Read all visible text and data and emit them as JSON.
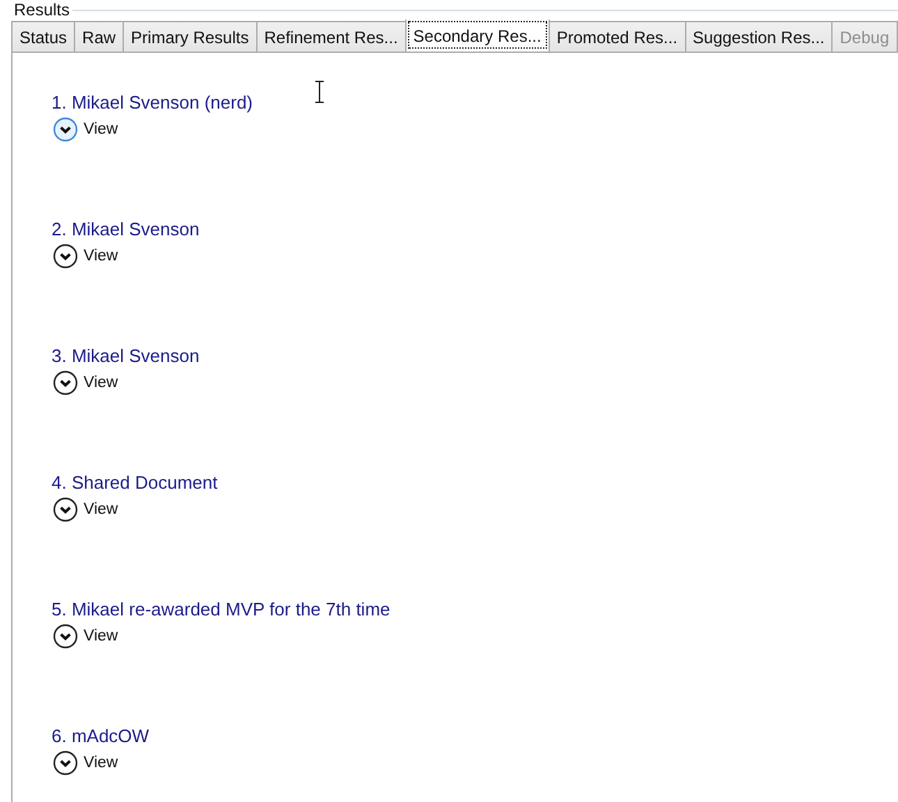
{
  "group": {
    "title": "Results"
  },
  "tabs": [
    {
      "label": "Status",
      "selected": false,
      "disabled": false
    },
    {
      "label": "Raw",
      "selected": false,
      "disabled": false
    },
    {
      "label": "Primary Results",
      "selected": false,
      "disabled": false
    },
    {
      "label": "Refinement Res...",
      "selected": false,
      "disabled": false
    },
    {
      "label": "Secondary Res...",
      "selected": true,
      "disabled": false
    },
    {
      "label": "Promoted Res...",
      "selected": false,
      "disabled": false
    },
    {
      "label": "Suggestion Res...",
      "selected": false,
      "disabled": false
    },
    {
      "label": "Debug",
      "selected": false,
      "disabled": true
    }
  ],
  "results": [
    {
      "title": "1. Mikael Svenson (nerd)",
      "action": "View",
      "highlighted": true
    },
    {
      "title": "2. Mikael Svenson",
      "action": "View",
      "highlighted": false
    },
    {
      "title": "3. Mikael Svenson",
      "action": "View",
      "highlighted": false
    },
    {
      "title": "4. Shared Document",
      "action": "View",
      "highlighted": false
    },
    {
      "title": "5. Mikael re-awarded MVP for the 7th time",
      "action": "View",
      "highlighted": false
    },
    {
      "title": "6. mAdcOW",
      "action": "View",
      "highlighted": false
    }
  ]
}
